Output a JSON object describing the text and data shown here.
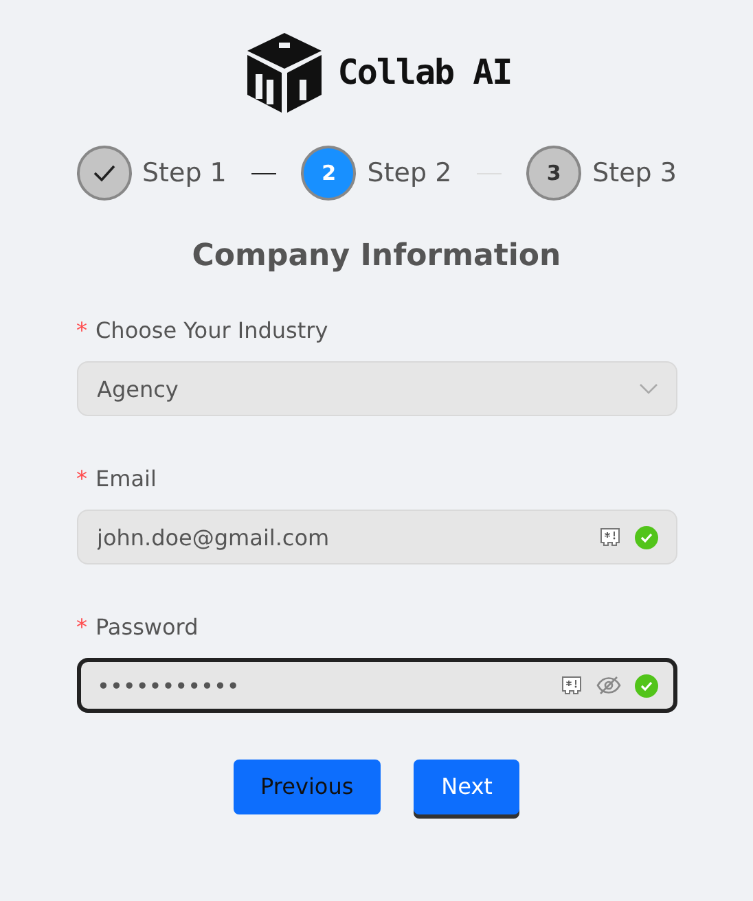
{
  "brand": {
    "name": "Collab AI"
  },
  "steps": [
    {
      "label": "Step 1",
      "completed": true,
      "selected": false
    },
    {
      "number": "2",
      "label": "Step 2",
      "completed": false,
      "selected": true
    },
    {
      "number": "3",
      "label": "Step 3",
      "completed": false,
      "selected": false
    }
  ],
  "title": "Company Information",
  "fields": [
    {
      "kind": "select",
      "required_mark": "*",
      "label": "Choose Your Industry",
      "value": "Agency",
      "valid": false,
      "focused": false
    },
    {
      "kind": "text",
      "required_mark": "*",
      "label": "Email",
      "value": "john.doe@gmail.com",
      "valid": true,
      "focused": false
    },
    {
      "kind": "password",
      "required_mark": "*",
      "label": "Password",
      "value": "•••••••••••",
      "valid": true,
      "focused": true
    }
  ],
  "buttons": [
    "Previous",
    "Next"
  ]
}
